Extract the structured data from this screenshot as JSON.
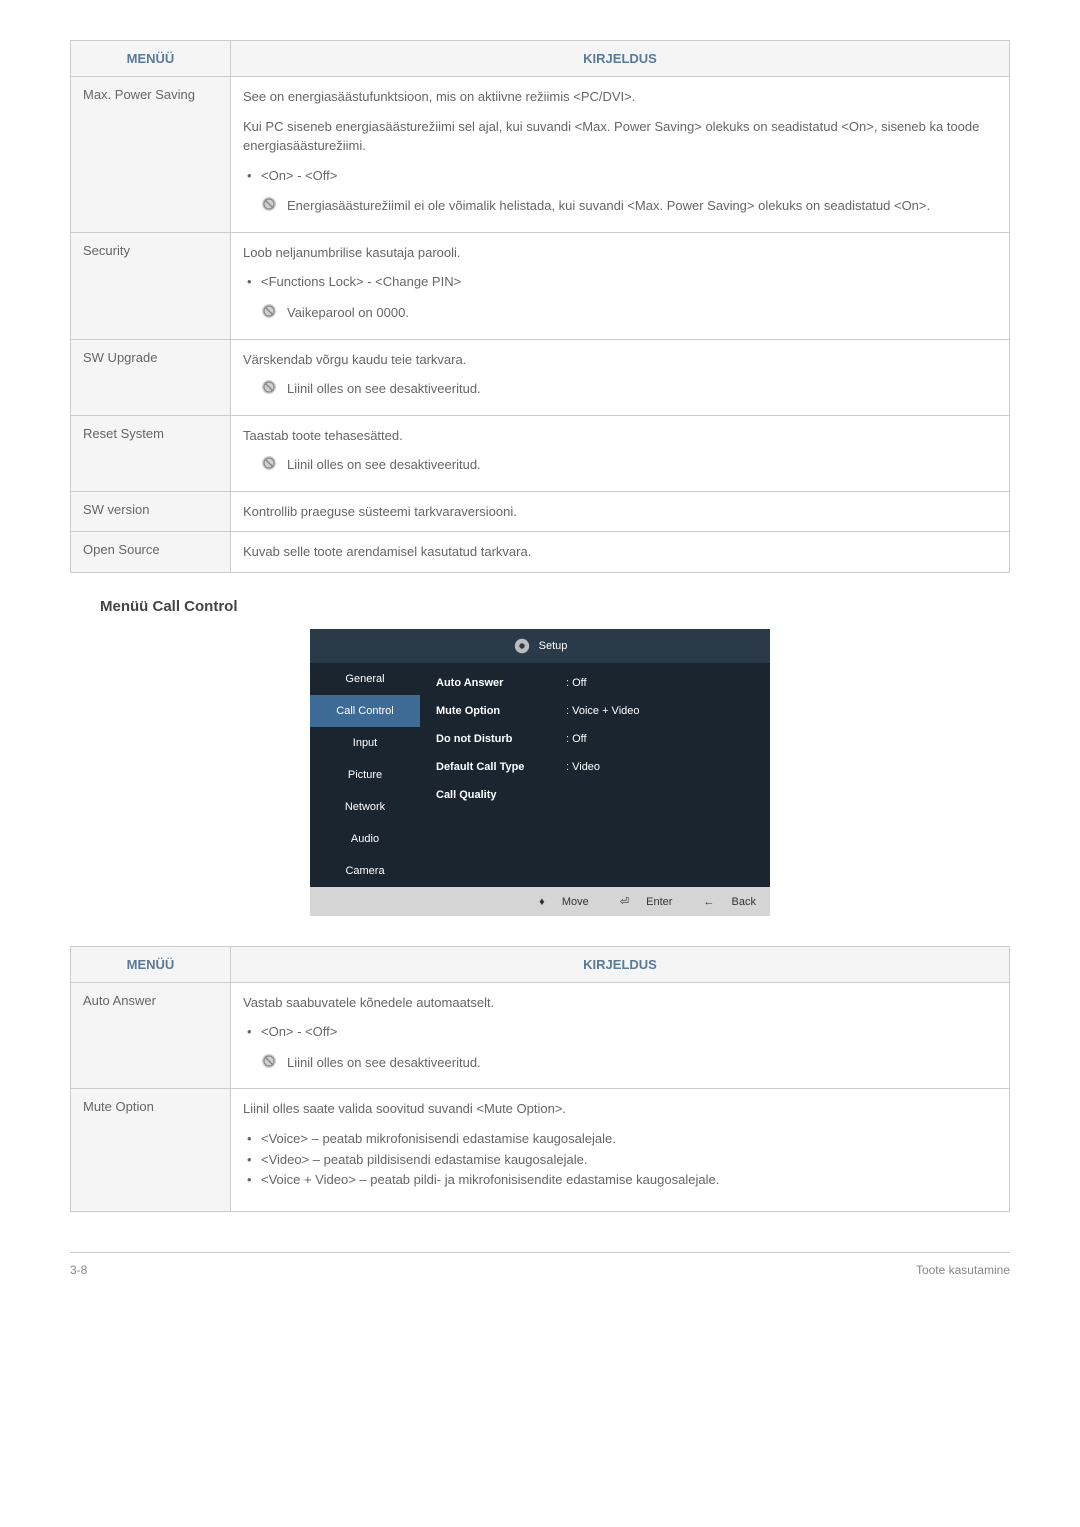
{
  "table1": {
    "header_menu": "MENÜÜ",
    "header_desc": "KIRJELDUS",
    "rows": [
      {
        "menu": "Max. Power Saving",
        "p1": "See on energiasäästufunktsioon, mis on aktiivne režiimis <PC/DVI>.",
        "p2": "Kui PC siseneb energiasäästurežiimi sel ajal, kui suvandi <Max. Power Saving> olekuks on seadistatud <On>, siseneb ka toode energiasäästurežiimi.",
        "bullet1": "<On> - <Off>",
        "note1": "Energiasäästurežiimil ei ole võimalik helistada, kui suvandi <Max. Power Saving> olekuks on seadistatud <On>."
      },
      {
        "menu": "Security",
        "p1": "Loob neljanumbrilise kasutaja parooli.",
        "bullet1": "<Functions Lock> - <Change PIN>",
        "note1": "Vaikeparool on 0000."
      },
      {
        "menu": "SW Upgrade",
        "p1": "Värskendab võrgu kaudu teie tarkvara.",
        "note1": "Liinil olles on see desaktiveeritud."
      },
      {
        "menu": "Reset System",
        "p1": "Taastab toote tehasesätted.",
        "note1": "Liinil olles on see desaktiveeritud."
      },
      {
        "menu": "SW version",
        "p1": "Kontrollib praeguse süsteemi tarkvaraversiooni."
      },
      {
        "menu": "Open Source",
        "p1": "Kuvab selle toote arendamisel kasutatud tarkvara."
      }
    ]
  },
  "section_title": "Menüü Call Control",
  "setup": {
    "title": "Setup",
    "sidebar": [
      "General",
      "Call Control",
      "Input",
      "Picture",
      "Network",
      "Audio",
      "Camera"
    ],
    "active_index": 1,
    "options": [
      {
        "label": "Auto Answer",
        "value": ": Off"
      },
      {
        "label": "Mute Option",
        "value": ": Voice + Video"
      },
      {
        "label": "Do not Disturb",
        "value": ": Off"
      },
      {
        "label": "Default Call Type",
        "value": ": Video"
      },
      {
        "label": "Call Quality",
        "value": ""
      }
    ],
    "footer": {
      "move": "Move",
      "move_icon": "♦",
      "enter": "Enter",
      "enter_icon": "⏎",
      "back": "Back",
      "back_icon": "←"
    }
  },
  "table2": {
    "header_menu": "MENÜÜ",
    "header_desc": "KIRJELDUS",
    "rows": [
      {
        "menu": "Auto Answer",
        "p1": "Vastab saabuvatele kõnedele automaatselt.",
        "bullet1": "<On> - <Off>",
        "note1": "Liinil olles on see desaktiveeritud."
      },
      {
        "menu": "Mute Option",
        "p1": "Liinil olles saate valida soovitud suvandi <Mute Option>.",
        "bullets": [
          "<Voice> – peatab mikrofonisisendi edastamise kaugosalejale.",
          "<Video> – peatab pildisisendi edastamise kaugosalejale.",
          "<Voice + Video> – peatab pildi- ja mikrofonisisendite edastamise kaugosalejale."
        ]
      }
    ]
  },
  "footer": {
    "left": "3-8",
    "right": "Toote kasutamine"
  }
}
